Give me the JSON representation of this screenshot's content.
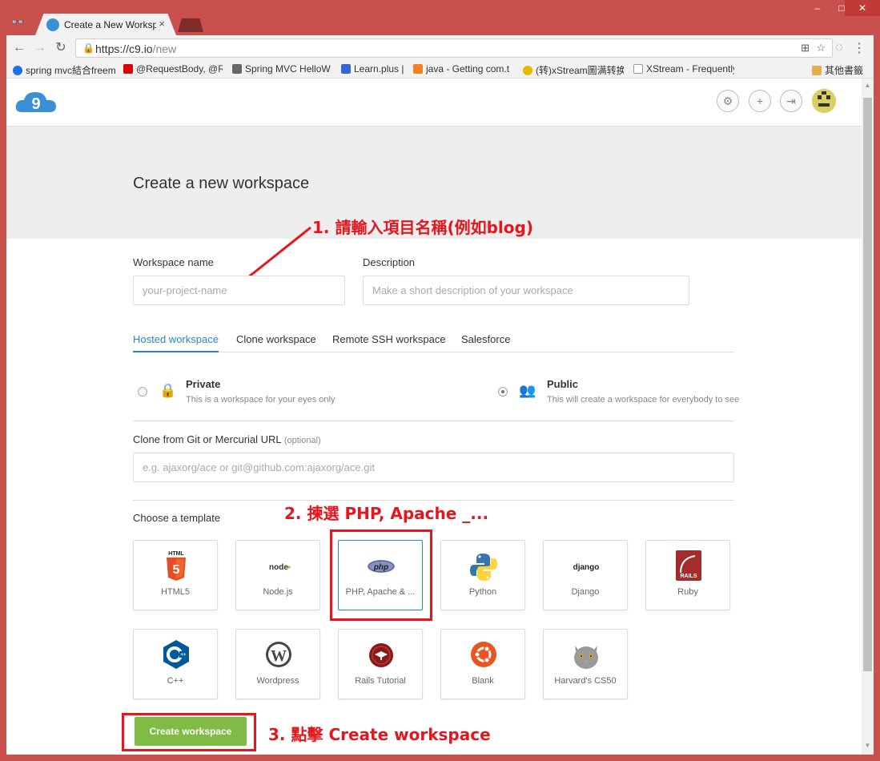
{
  "browser": {
    "tab_title": "Create a New Workspace",
    "tab_close": "×",
    "url_host": "https://c9.io",
    "url_path": "/new",
    "bookmarks": [
      {
        "label": "spring mvc結合freem",
        "color": "#1a73e8"
      },
      {
        "label": "@RequestBody, @R",
        "color": "#d00"
      },
      {
        "label": "Spring MVC HelloW",
        "color": "#666"
      },
      {
        "label": "Learn.plus |",
        "color": "#3367d6"
      },
      {
        "label": "java - Getting com.t",
        "color": "#f48024"
      },
      {
        "label": "(转)xStream圖满转换",
        "color": "#e6b800"
      },
      {
        "label": "XStream - Frequently",
        "color": "#999"
      }
    ],
    "bookmarks_other": "其他書籤",
    "window_controls": [
      "–",
      "□",
      "✕"
    ]
  },
  "header": {
    "logo_text": "9",
    "buttons": [
      "gear-icon",
      "plus-icon",
      "logout-icon"
    ],
    "button_glyphs": [
      "⚙",
      "+",
      "⇥"
    ]
  },
  "page": {
    "title": "Create a new workspace"
  },
  "form": {
    "name_label": "Workspace name",
    "name_placeholder": "your-project-name",
    "desc_label": "Description",
    "desc_placeholder": "Make a short description of your workspace",
    "tabs": [
      "Hosted workspace",
      "Clone workspace",
      "Remote SSH workspace",
      "Salesforce"
    ],
    "active_tab": "Hosted workspace",
    "private_title": "Private",
    "private_desc": "This is a workspace for your eyes only",
    "public_title": "Public",
    "public_desc": "This will create a workspace for everybody to see",
    "selected_visibility": "Public",
    "clone_label": "Clone from Git or Mercurial URL",
    "clone_optional": "(optional)",
    "clone_placeholder": "e.g. ajaxorg/ace or git@github.com:ajaxorg/ace.git",
    "template_label": "Choose a template",
    "templates_row1": [
      "HTML5",
      "Node.js",
      "PHP, Apache & ...",
      "Python",
      "Django",
      "Ruby"
    ],
    "templates_row2": [
      "C++",
      "Wordpress",
      "Rails Tutorial",
      "Blank",
      "Harvard's CS50"
    ],
    "selected_template": "PHP, Apache & ...",
    "create_button": "Create workspace"
  },
  "annotations": {
    "step1": "1. 請輸入項目名稱(例如blog)",
    "step2": "2. 揀選 PHP, Apache _...",
    "step3": "3. 點擊 Create workspace",
    "color": "#e8161c"
  },
  "icons": {
    "html5": "html5-logo",
    "node": "nodejs-logo",
    "php": "php-logo",
    "python": "python-logo",
    "django": "django-logo",
    "ruby": "rails-logo",
    "cpp": "cpp-logo",
    "wordpress": "wordpress-logo",
    "rails_tutorial": "rails-tutorial-logo",
    "blank": "ubuntu-logo",
    "cs50": "cat-logo",
    "html5_label": "HTML",
    "node_label": "node",
    "php_label": "php",
    "django_label": "django",
    "rails_label": "RAILS"
  }
}
